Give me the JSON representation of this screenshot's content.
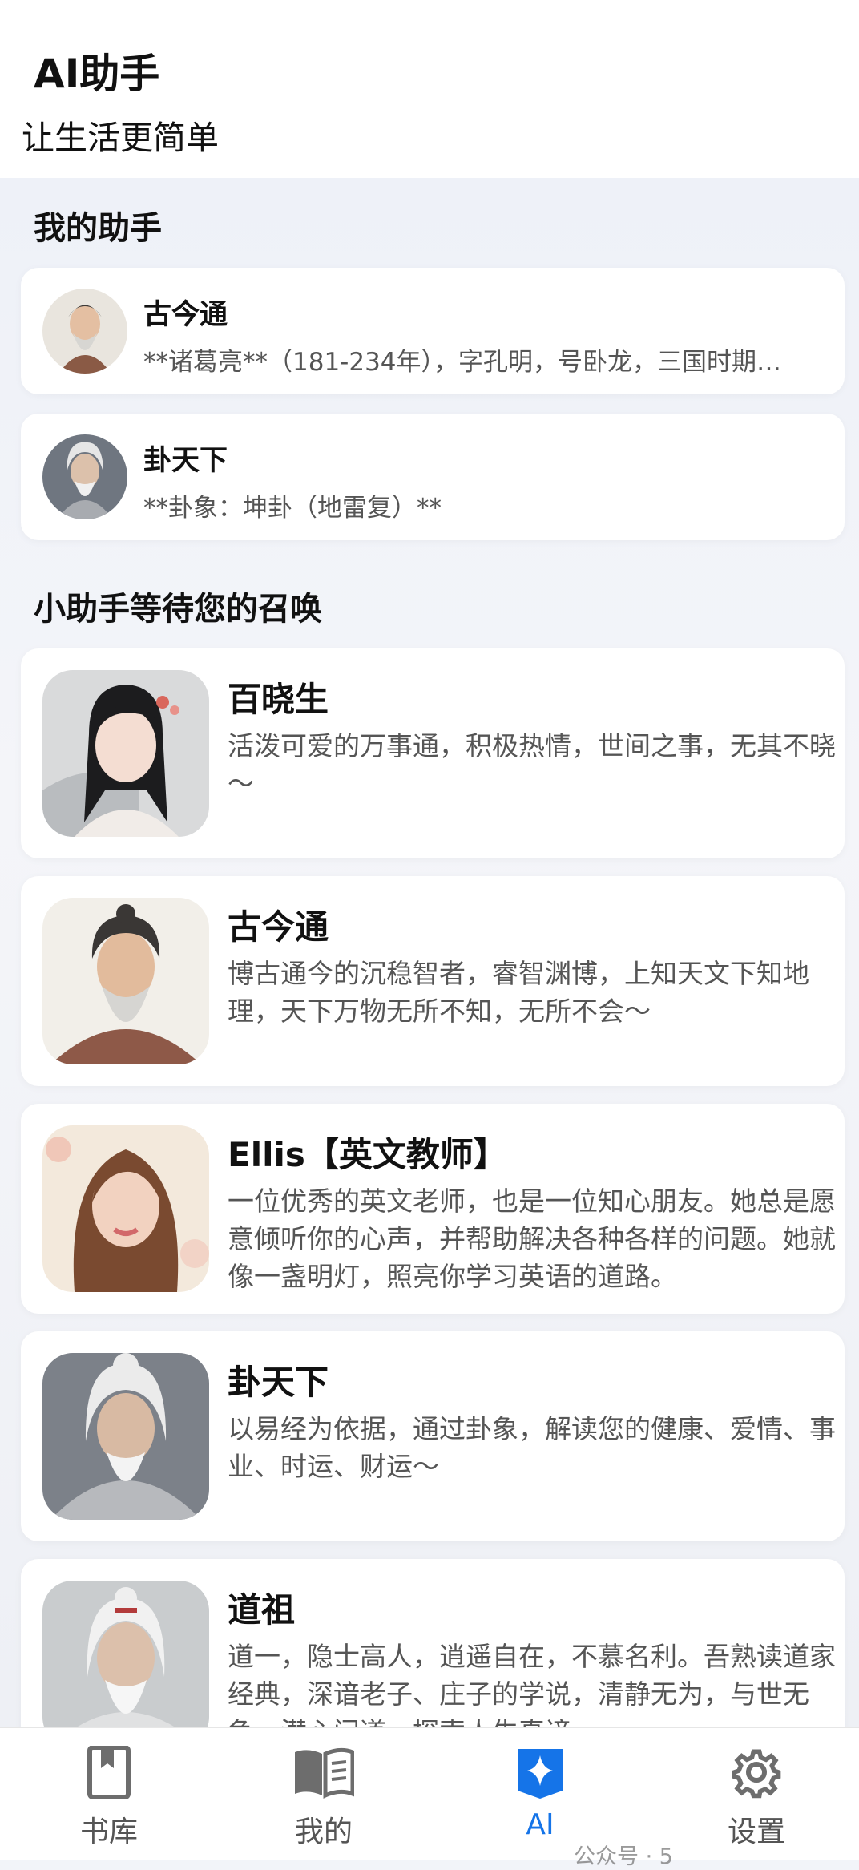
{
  "header": {
    "title": "AI助手",
    "subtitle": "让生活更简单"
  },
  "my_assistants": {
    "title": "我的助手",
    "items": [
      {
        "name": "古今通",
        "desc": "**诸葛亮**（181-234年），字孔明，号卧龙，三国时期…"
      },
      {
        "name": "卦天下",
        "desc": "**卦象：坤卦（地雷复）**"
      }
    ]
  },
  "summon": {
    "title": "小助手等待您的召唤",
    "items": [
      {
        "name": "百晓生",
        "desc": "活泼可爱的万事通，积极热情，世间之事，无其不晓～"
      },
      {
        "name": "古今通",
        "desc": "博古通今的沉稳智者，睿智渊博，上知天文下知地理，天下万物无所不知，无所不会～"
      },
      {
        "name": "Ellis【英文教师】",
        "desc": "一位优秀的英文老师，也是一位知心朋友。她总是愿意倾听你的心声，并帮助解决各种各样的问题。她就像一盏明灯，照亮你学习英语的道路。"
      },
      {
        "name": "卦天下",
        "desc": "以易经为依据，通过卦象，解读您的健康、爱情、事业、时运、财运～"
      },
      {
        "name": "道祖",
        "desc": "道一，隐士高人，逍遥自在，不慕名利。吾熟读道家经典，深谙老子、庄子的学说，清静无为，与世无争，潜心问道，探索人生真谛。"
      }
    ]
  },
  "tabbar": {
    "tabs": [
      {
        "label": "书库",
        "icon": "bookmark-book-icon"
      },
      {
        "label": "我的",
        "icon": "open-book-icon"
      },
      {
        "label": "AI",
        "icon": "ai-sparkle-icon",
        "active": true
      },
      {
        "label": "设置",
        "icon": "gear-icon"
      }
    ],
    "active_color": "#1574e8"
  },
  "watermark": "公众号 · 5"
}
